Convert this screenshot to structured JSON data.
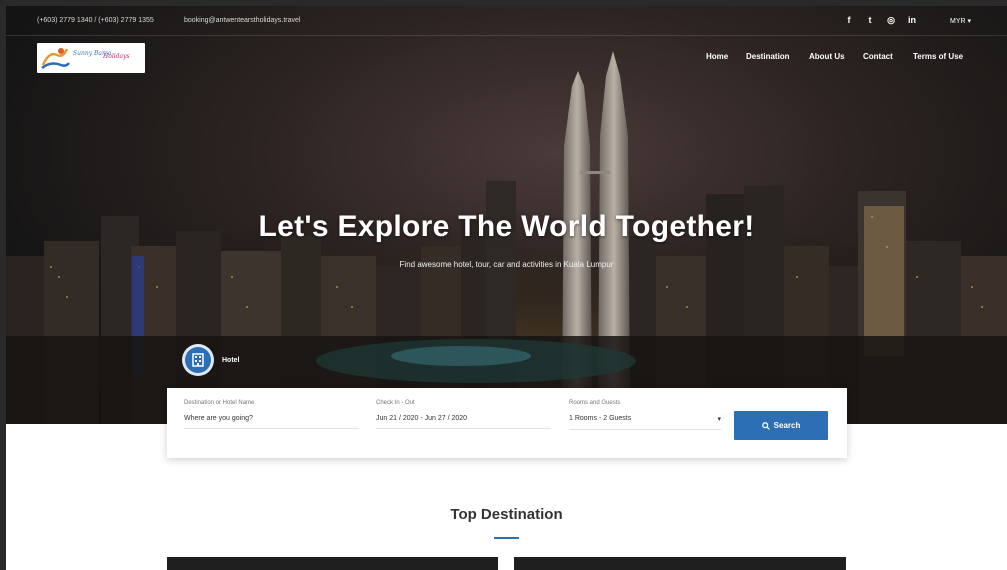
{
  "topbar": {
    "phone": "(+603) 2779 1340 / (+603) 2779 1355",
    "email": "booking@antwentearstholidays.travel",
    "social": [
      {
        "icon": "facebook-icon",
        "glyph": "f"
      },
      {
        "icon": "twitter-icon",
        "glyph": "t"
      },
      {
        "icon": "instagram-icon",
        "glyph": "◎"
      },
      {
        "icon": "linkedin-icon",
        "glyph": "in"
      }
    ],
    "currency": "MYR ▾"
  },
  "logo": {
    "text1": "Sunny Barra",
    "text2": "Holidays"
  },
  "nav": {
    "home": "Home",
    "destination": "Destination",
    "about": "About Us",
    "contact": "Contact",
    "terms": "Terms of Use"
  },
  "hero": {
    "headline": "Let's Explore The World Together!",
    "subline": "Find awesome hotel, tour, car and activities in Kuala Lumpur",
    "tab_label": "Hotel"
  },
  "search": {
    "destination_label": "Destination or Hotel Name",
    "destination_placeholder": "Where are you going?",
    "checkin_label": "Check In - Out",
    "checkin_value": "Jun 21 / 2020 - Jun 27 / 2020",
    "rooms_label": "Rooms and Guests",
    "rooms_value": "1 Rooms - 2 Guests",
    "button": "Search"
  },
  "section": {
    "title": "Top Destination"
  },
  "colors": {
    "accent": "#2d6fb4"
  }
}
